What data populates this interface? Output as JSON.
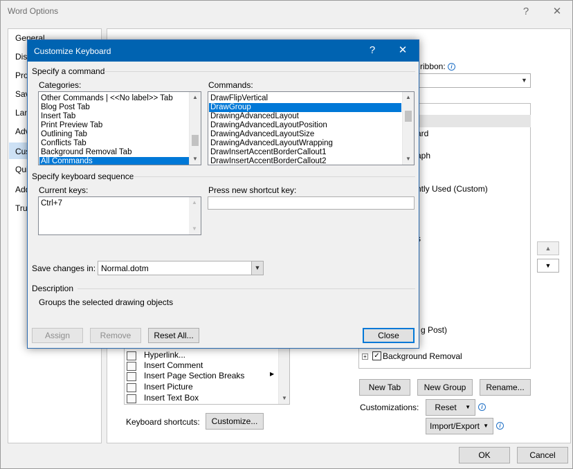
{
  "word_options": {
    "title": "Word Options",
    "help_glyph": "?",
    "close_glyph": "✕",
    "nav": [
      "General",
      "Disp",
      "Pro",
      "Sav",
      "Lan",
      "Adv",
      "Cus",
      "Qui",
      "Add",
      "Tru"
    ],
    "customize_ribbon_label_fragment": "ribbon:",
    "tree_items": [
      "ard",
      "aph",
      "ntly Used (Custom)",
      "s",
      "g Post)",
      "Background Removal"
    ],
    "left_list_items": [
      "Hyperlink...",
      "Insert Comment",
      "Insert Page  Section Breaks",
      "Insert Picture",
      "Insert Text Box"
    ],
    "keyboard_shortcuts_label": "Keyboard shortcuts:",
    "customize_button": "Customize...",
    "new_tab_button": "New Tab",
    "new_group_button": "New Group",
    "rename_button": "Rename...",
    "customizations_label": "Customizations:",
    "reset_button": "Reset",
    "import_export_button": "Import/Export",
    "ok_button": "OK",
    "cancel_button": "Cancel"
  },
  "dialog": {
    "title": "Customize Keyboard",
    "help_glyph": "?",
    "close_glyph": "✕",
    "specify_command": "Specify a command",
    "categories_label": "Categories:",
    "categories": [
      "Other Commands | <<No label>> Tab",
      "Blog Post Tab",
      "Insert Tab",
      "Print Preview Tab",
      "Outlining Tab",
      "Conflicts Tab",
      "Background Removal Tab",
      "All Commands"
    ],
    "categories_selected": "All Commands",
    "commands_label": "Commands:",
    "commands": [
      "DrawFlipVertical",
      "DrawGroup",
      "DrawingAdvancedLayout",
      "DrawingAdvancedLayoutPosition",
      "DrawingAdvancedLayoutSize",
      "DrawingAdvancedLayoutWrapping",
      "DrawInsertAccentBorderCallout1",
      "DrawInsertAccentBorderCallout2"
    ],
    "commands_selected": "DrawGroup",
    "specify_sequence": "Specify keyboard sequence",
    "current_keys_label": "Current keys:",
    "current_keys": [
      "Ctrl+7"
    ],
    "press_new_label": "Press new shortcut key:",
    "press_new_value": "",
    "save_changes_label": "Save changes in:",
    "save_changes_value": "Normal.dotm",
    "description_heading": "Description",
    "description_text": "Groups the selected drawing objects",
    "assign_button": "Assign",
    "remove_button": "Remove",
    "reset_all_button": "Reset All...",
    "close_button": "Close"
  }
}
